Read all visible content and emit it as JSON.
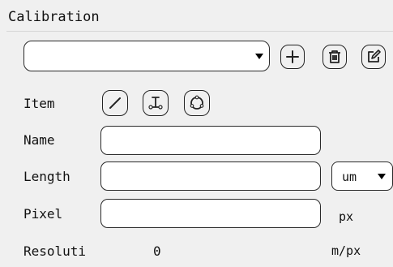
{
  "section": {
    "title": "Calibration"
  },
  "calibration_select": {
    "value": ""
  },
  "toolbar": {
    "add_icon": "plus-icon",
    "delete_icon": "trash-icon",
    "edit_icon": "edit-icon"
  },
  "form": {
    "item_label": "Item",
    "item_tools": [
      "line-tool-icon",
      "perpendicular-tool-icon",
      "circle-tool-icon"
    ],
    "name_label": "Name",
    "name_value": "",
    "length_label": "Length",
    "length_value": "",
    "length_unit": "um",
    "pixel_label": "Pixel",
    "pixel_value": "",
    "pixel_unit": "px",
    "resolution_label": "Resoluti",
    "resolution_value": "0",
    "resolution_unit": "m/px"
  }
}
